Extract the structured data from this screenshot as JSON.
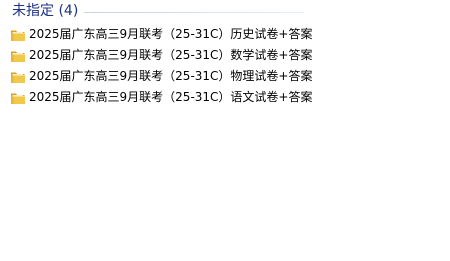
{
  "group": {
    "title": "未指定 (4)"
  },
  "items": [
    {
      "name": "2025届广东高三9月联考（25-31C）历史试卷+答案",
      "icon": "folder-icon"
    },
    {
      "name": "2025届广东高三9月联考（25-31C）数学试卷+答案",
      "icon": "folder-icon"
    },
    {
      "name": "2025届广东高三9月联考（25-31C）物理试卷+答案",
      "icon": "folder-icon"
    },
    {
      "name": "2025届广东高三9月联考（25-31C）语文试卷+答案",
      "icon": "folder-icon"
    }
  ],
  "colors": {
    "group_title": "#1e3287",
    "folder_front": "#f0c84a",
    "folder_back": "#d9a520"
  }
}
